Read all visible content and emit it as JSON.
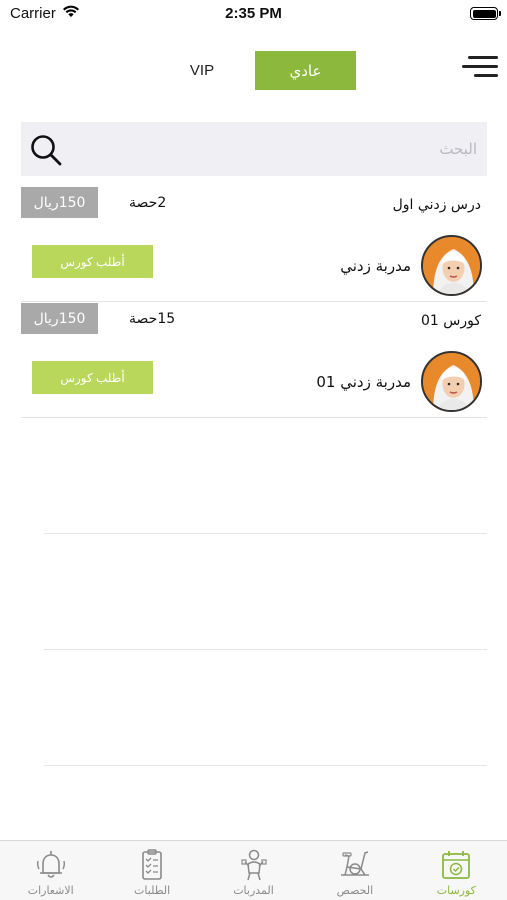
{
  "status_bar": {
    "carrier": "Carrier",
    "time": "2:35 PM"
  },
  "header": {
    "tabs": [
      {
        "label": "عادي",
        "active": true
      },
      {
        "label": "VIP",
        "active": false
      }
    ]
  },
  "search": {
    "placeholder": "البحث",
    "value": ""
  },
  "courses": [
    {
      "title": "درس زدني اول",
      "sessions": "2حصة",
      "price": "150ريال",
      "trainer": "مدربة زدني",
      "request_label": "أطلب كورس"
    },
    {
      "title": "كورس 01",
      "sessions": "15حصة",
      "price": "150ريال",
      "trainer": "مدربة زدني 01",
      "request_label": "أطلب كورس"
    }
  ],
  "tabbar": {
    "items": [
      {
        "label": "الاشعارات",
        "icon": "bell-icon"
      },
      {
        "label": "الطلبات",
        "icon": "clipboard-icon"
      },
      {
        "label": "المدربات",
        "icon": "trainer-icon"
      },
      {
        "label": "الحصص",
        "icon": "exercise-bike-icon"
      },
      {
        "label": "كورسات",
        "icon": "calendar-check-icon",
        "active": true
      }
    ]
  },
  "colors": {
    "accent": "#8cb83e",
    "button": "#b9d75a",
    "price_bg": "#a9a9a9",
    "search_bg": "#efeff4"
  }
}
